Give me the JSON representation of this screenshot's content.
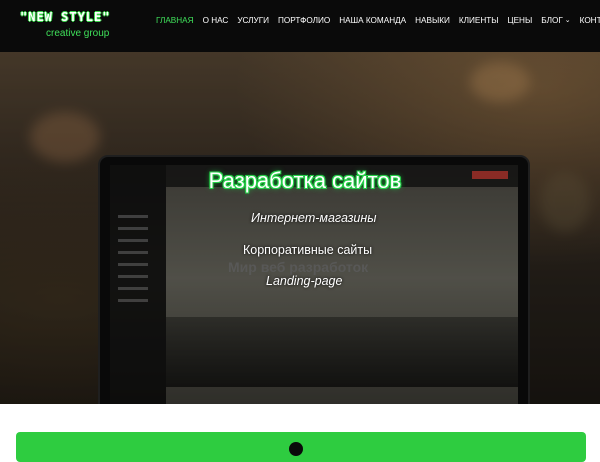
{
  "logo": {
    "title": "\"NEW STYLE\"",
    "subtitle": "creative group"
  },
  "nav": {
    "items": [
      {
        "label": "ГЛАВНАЯ",
        "active": true
      },
      {
        "label": "О НАС"
      },
      {
        "label": "УСЛУГИ"
      },
      {
        "label": "ПОРТФОЛИО"
      },
      {
        "label": "НАША КОМАНДА"
      },
      {
        "label": "НАВЫКИ"
      },
      {
        "label": "КЛИЕНТЫ"
      },
      {
        "label": "ЦЕНЫ"
      },
      {
        "label": "БЛОГ",
        "dropdown": true
      },
      {
        "label": "КОНТАКТЫ"
      }
    ]
  },
  "hero": {
    "title": "Разработка сайтов",
    "services": [
      "Интернет-магазины",
      "Корпоративные сайты",
      "Landing-page"
    ],
    "screen_text": "Мир веб разработок"
  },
  "colors": {
    "accent": "#3fe05a",
    "header_bg": "#0a0a0a",
    "green_bar": "#2ecc40"
  },
  "icons": {
    "dropdown": "chevron-down-icon"
  }
}
